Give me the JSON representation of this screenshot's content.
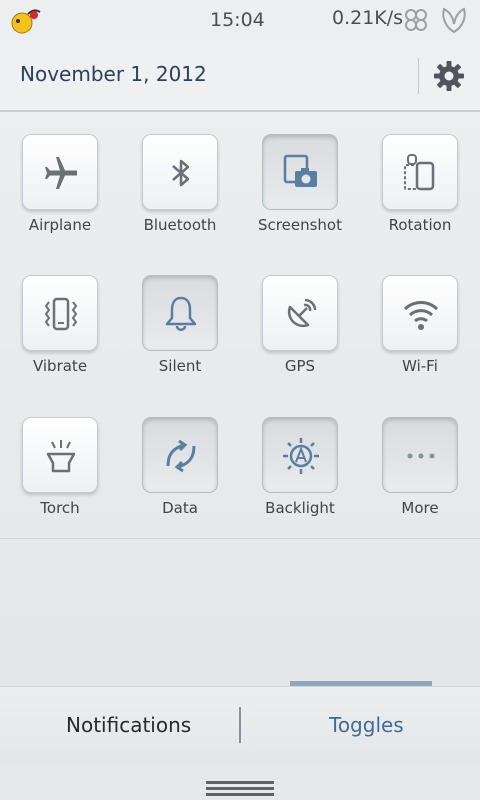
{
  "status_bar": {
    "time": "15:04",
    "net_speed": "0.21K/s",
    "icons": [
      "app-notification-icon",
      "sync-status-icon",
      "leaf-status-icon"
    ]
  },
  "header": {
    "date": "November 1, 2012",
    "settings_icon": "gear-icon"
  },
  "toggles": [
    {
      "label": "Airplane",
      "icon": "airplane-icon",
      "active": false
    },
    {
      "label": "Bluetooth",
      "icon": "bluetooth-icon",
      "active": false
    },
    {
      "label": "Screenshot",
      "icon": "screenshot-icon",
      "active": true
    },
    {
      "label": "Rotation",
      "icon": "rotation-icon",
      "active": false
    },
    {
      "label": "Vibrate",
      "icon": "vibrate-icon",
      "active": false
    },
    {
      "label": "Silent",
      "icon": "bell-icon",
      "active": true
    },
    {
      "label": "GPS",
      "icon": "gps-icon",
      "active": false
    },
    {
      "label": "Wi-Fi",
      "icon": "wifi-icon",
      "active": false
    },
    {
      "label": "Torch",
      "icon": "torch-icon",
      "active": false
    },
    {
      "label": "Data",
      "icon": "data-icon",
      "active": true
    },
    {
      "label": "Backlight",
      "icon": "backlight-icon",
      "active": true
    },
    {
      "label": "More",
      "icon": "more-icon",
      "active": true
    }
  ],
  "tabs": {
    "notifications": "Notifications",
    "toggles": "Toggles",
    "selected": "Toggles"
  },
  "colors": {
    "accent": "#8fa7bd",
    "active_icon": "#5a7da0",
    "inactive_icon": "#6b7075",
    "date_text": "#2f3f5a"
  }
}
